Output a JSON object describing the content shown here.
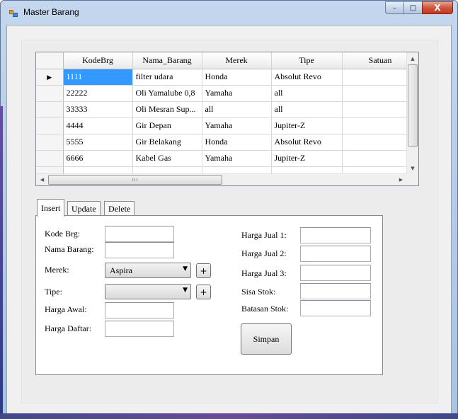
{
  "window": {
    "title": "Master Barang",
    "controls": {
      "minimize": "–",
      "maximize": "□",
      "close": "X"
    }
  },
  "grid": {
    "columns": [
      "KodeBrg",
      "Nama_Barang",
      "Merek",
      "Tipe",
      "Satuan"
    ],
    "current_row_marker": "▶",
    "rows": [
      {
        "cells": [
          "1111",
          "filter udara",
          "Honda",
          "Absolut Revo",
          ""
        ]
      },
      {
        "cells": [
          "22222",
          "Oli Yamalube 0,8",
          "Yamaha",
          "all",
          ""
        ]
      },
      {
        "cells": [
          "33333",
          "Oli Mesran Sup...",
          "all",
          "all",
          ""
        ]
      },
      {
        "cells": [
          "4444",
          "Gir Depan",
          "Yamaha",
          "Jupiter-Z",
          ""
        ]
      },
      {
        "cells": [
          "5555",
          "Gir Belakang",
          "Honda",
          "Absolut Revo",
          ""
        ]
      },
      {
        "cells": [
          "6666",
          "Kabel Gas",
          "Yamaha",
          "Jupiter-Z",
          ""
        ]
      }
    ],
    "hscroll_grip": "III"
  },
  "tabs": [
    "Insert",
    "Update",
    "Delete"
  ],
  "form": {
    "kode_brg": {
      "label": "Kode Brg:",
      "value": ""
    },
    "nama_barang": {
      "label": "Nama Barang:",
      "value": ""
    },
    "merek": {
      "label": "Merek:",
      "value": "Aspira"
    },
    "tipe": {
      "label": "Tipe:",
      "value": ""
    },
    "harga_awal": {
      "label": "Harga Awal:",
      "value": ""
    },
    "harga_daftar": {
      "label": "Harga Daftar:",
      "value": ""
    },
    "harga_jual_1": {
      "label": "Harga Jual 1:",
      "value": ""
    },
    "harga_jual_2": {
      "label": "Harga Jual 2:",
      "value": ""
    },
    "harga_jual_3": {
      "label": "Harga Jual 3:",
      "value": ""
    },
    "sisa_stok": {
      "label": "Sisa Stok:",
      "value": ""
    },
    "batasan_stok": {
      "label": "Batasan Stok:",
      "value": ""
    },
    "plus_label": "+",
    "submit_label": "Simpan"
  },
  "colors": {
    "selection": "#3399ff",
    "title_gradient_top": "#c4d7ee",
    "close_button": "#c23b23"
  }
}
